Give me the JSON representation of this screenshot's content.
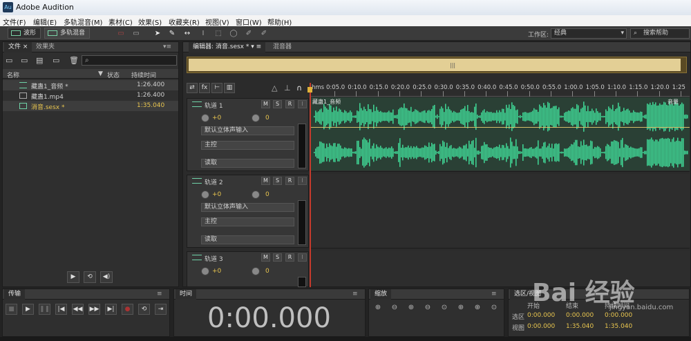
{
  "app": {
    "title": "Adobe Audition",
    "logo": "Au"
  },
  "menu": [
    "文件(F)",
    "编辑(E)",
    "多轨混音(M)",
    "素材(C)",
    "效果(S)",
    "收藏夹(R)",
    "视图(V)",
    "窗口(W)",
    "帮助(H)"
  ],
  "toolbar": {
    "waveform": "波形",
    "multitrack": "多轨混音",
    "workspace_label": "工作区:",
    "workspace_value": "经典",
    "search_help": "搜索帮助"
  },
  "files_panel": {
    "tab_files": "文件",
    "tab_effects": "效果夹",
    "columns": {
      "name": "名称",
      "status": "状态",
      "duration": "持续时间"
    },
    "rows": [
      {
        "name": "藏蛊1_音频 *",
        "duration": "1:26.400",
        "type": "audio"
      },
      {
        "name": "藏蛊1.mp4",
        "duration": "1:26.400",
        "type": "video"
      },
      {
        "name": "消音.sesx *",
        "duration": "1:35.040",
        "type": "session"
      }
    ]
  },
  "editor": {
    "tab_editor": "编辑器: 消音.sesx *",
    "tab_mixer": "混音器",
    "ruler": {
      "unit": "hms",
      "labels": [
        "0:05.0",
        "0:10.0",
        "0:15.0",
        "0:20.0",
        "0:25.0",
        "0:30.0",
        "0:35.0",
        "0:40.0",
        "0:45.0",
        "0:50.0",
        "0:55.0",
        "1:00.0",
        "1:05.0",
        "1:10.0",
        "1:15.0",
        "1:20.0",
        "1:25"
      ]
    },
    "clip": {
      "name": "藏蛊1_音频",
      "volume_label": "音量",
      "color": "#3fd091"
    },
    "tracks": [
      {
        "name": "轨道 1",
        "volume": "+0",
        "pan": "0",
        "input": "默认立体声输入",
        "output": "主控",
        "automation": "读取"
      },
      {
        "name": "轨道 2",
        "volume": "+0",
        "pan": "0",
        "input": "默认立体声输入",
        "output": "主控",
        "automation": "读取"
      },
      {
        "name": "轨道 3",
        "volume": "+0",
        "pan": "0"
      }
    ],
    "track_buttons": {
      "m": "M",
      "s": "S",
      "r": "R",
      "i": "I"
    }
  },
  "transport": {
    "title": "传输"
  },
  "time": {
    "title": "时间",
    "display": "0:00.000"
  },
  "zoom": {
    "title": "缩放"
  },
  "selection": {
    "title": "选区/视图",
    "start": "开始",
    "end": "结束",
    "duration": "持续时间",
    "row_sel": "选区",
    "row_view": "视图",
    "sel_start": "0:00.000",
    "sel_end": "0:00.000",
    "sel_dur": "0:00.000",
    "view_start": "0:00.000",
    "view_end": "1:35.040",
    "view_dur": "1:35.040"
  },
  "watermark": {
    "text": "Bai 经验",
    "sub": "jingyan.baidu.com"
  }
}
